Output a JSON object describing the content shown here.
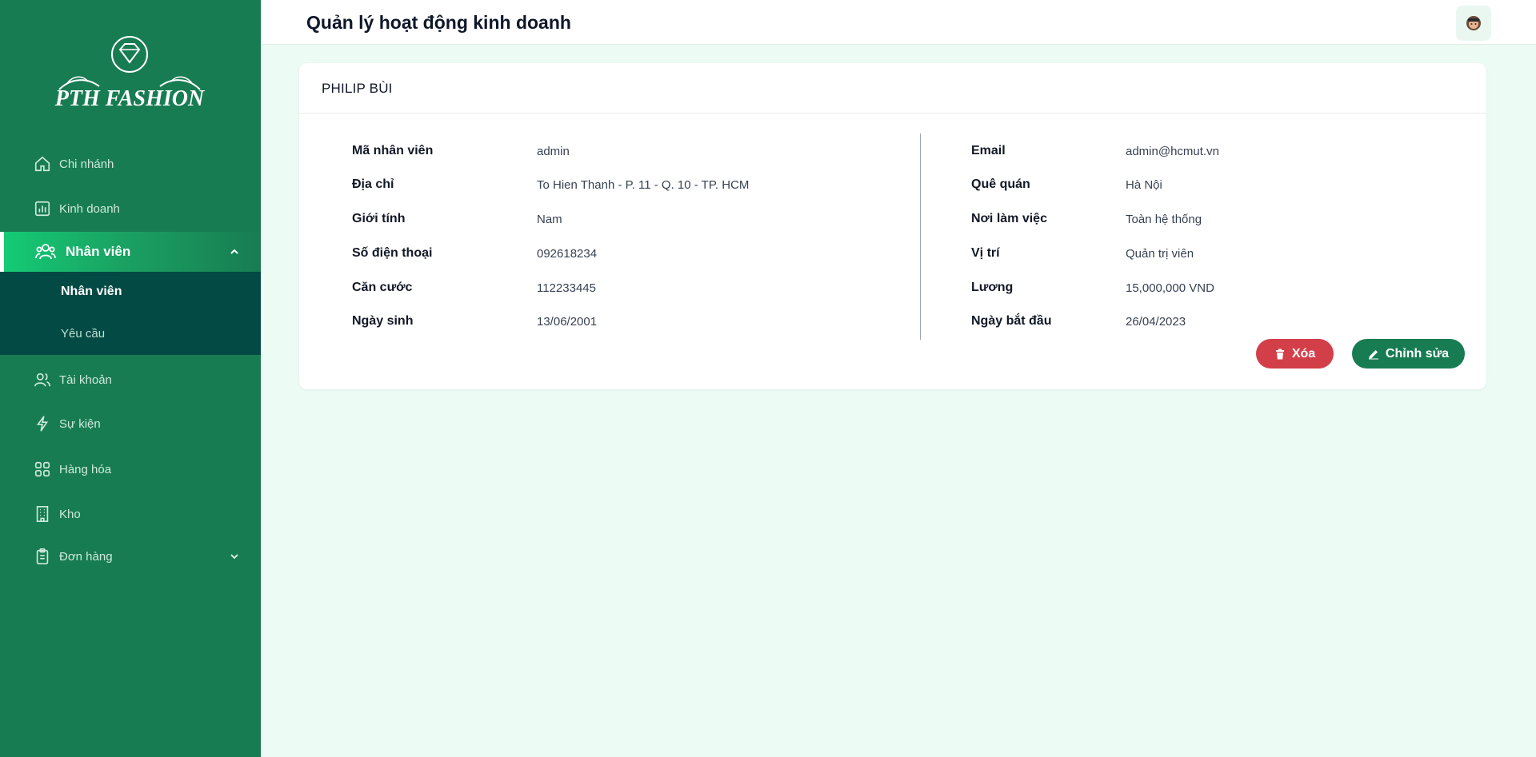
{
  "brand": {
    "logo_text": "PTH FASHION"
  },
  "header": {
    "title": "Quản lý hoạt động kinh doanh",
    "avatar_icon": "user-avatar"
  },
  "sidebar": {
    "items": [
      {
        "label": "Chi nhánh",
        "icon": "home-icon"
      },
      {
        "label": "Kinh doanh",
        "icon": "bar-chart-icon"
      },
      {
        "label": "Nhân viên",
        "icon": "users-icon",
        "expanded": true
      },
      {
        "label": "Tài khoản",
        "icon": "user-group-icon"
      },
      {
        "label": "Sự kiện",
        "icon": "lightning-icon"
      },
      {
        "label": "Hàng hóa",
        "icon": "grid-icon"
      },
      {
        "label": "Kho",
        "icon": "building-icon"
      },
      {
        "label": "Đơn hàng",
        "icon": "clipboard-icon",
        "expanded": false
      }
    ],
    "submenu": [
      {
        "label": "Nhân viên",
        "active": true
      },
      {
        "label": "Yêu cầu",
        "active": false
      }
    ]
  },
  "employee": {
    "name": "PHILIP BÙI",
    "left": [
      {
        "label": "Mã nhân viên",
        "value": "admin"
      },
      {
        "label": "Địa chỉ",
        "value": "To Hien Thanh - P. 11 - Q. 10 - TP. HCM"
      },
      {
        "label": "Giới tính",
        "value": "Nam"
      },
      {
        "label": "Số điện thoại",
        "value": "092618234"
      },
      {
        "label": "Căn cước",
        "value": "112233445"
      },
      {
        "label": "Ngày sinh",
        "value": "13/06/2001"
      }
    ],
    "right": [
      {
        "label": "Email",
        "value": "admin@hcmut.vn"
      },
      {
        "label": "Quê quán",
        "value": "Hà Nội"
      },
      {
        "label": "Nơi làm việc",
        "value": "Toàn hệ thống"
      },
      {
        "label": "Vị trí",
        "value": "Quản trị viên"
      },
      {
        "label": "Lương",
        "value": "15,000,000 VND"
      },
      {
        "label": "Ngày bắt đầu",
        "value": "26/04/2023"
      }
    ]
  },
  "actions": {
    "delete_label": "Xóa",
    "edit_label": "Chỉnh sửa"
  },
  "colors": {
    "sidebar": "#187c52",
    "submenu": "#034a44",
    "accent": "#14cc75",
    "delete": "#d33f49",
    "background": "#ecfbf4"
  }
}
